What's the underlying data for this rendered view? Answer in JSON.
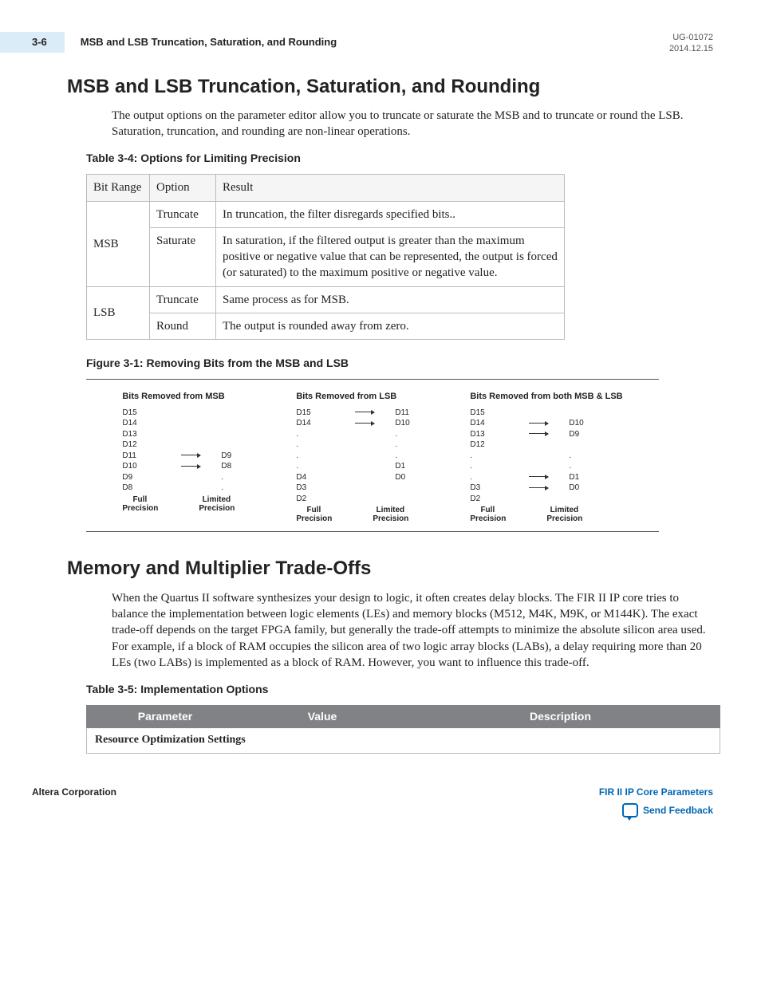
{
  "header": {
    "page_num": "3-6",
    "running_title": "MSB and LSB Truncation, Saturation, and Rounding",
    "doc_id": "UG-01072",
    "date": "2014.12.15"
  },
  "section1": {
    "title": "MSB and LSB Truncation, Saturation, and Rounding",
    "body": "The output options on the parameter editor allow you to truncate or saturate the MSB and to truncate or round the LSB. Saturation, truncation, and rounding are non-linear operations."
  },
  "table34": {
    "caption": "Table 3-4: Options for Limiting Precision",
    "headers": [
      "Bit Range",
      "Option",
      "Result"
    ],
    "rows": [
      {
        "range": "MSB",
        "option": "Truncate",
        "result": "In truncation, the filter disregards specified bits.."
      },
      {
        "range": "MSB",
        "option": "Saturate",
        "result": "In saturation, if the filtered output is greater than the maximum positive or negative value that can be represented, the output is forced (or saturated) to the maximum positive or negative value."
      },
      {
        "range": "LSB",
        "option": "Truncate",
        "result": "Same process as for MSB."
      },
      {
        "range": "LSB",
        "option": "Round",
        "result": "The output is rounded away from zero."
      }
    ]
  },
  "figure31": {
    "caption": "Figure 3-1: Removing Bits from the MSB and LSB",
    "cols": [
      {
        "title": "Bits Removed from MSB",
        "full": [
          "D15",
          "D14",
          "D13",
          "D12",
          "D11",
          "D10",
          "D9",
          "D8"
        ],
        "limited": [
          "",
          "",
          "",
          "",
          "D9",
          "D8",
          ".",
          "."
        ],
        "foot_left": "Full Precision",
        "foot_right": "Limited Precision",
        "arrows": {
          "4": true,
          "5": true
        }
      },
      {
        "title": "Bits Removed from LSB",
        "full": [
          "D15",
          "D14",
          ".",
          ".",
          ".",
          ".",
          "D4",
          "D3",
          "D2"
        ],
        "limited": [
          "D11",
          "D10",
          ".",
          ".",
          ".",
          "D1",
          "D0",
          "",
          ""
        ],
        "foot_left": "Full Precision",
        "foot_right": "Limited Precision",
        "arrows": {
          "0": true,
          "1": true
        }
      },
      {
        "title": "Bits Removed from both MSB & LSB",
        "full": [
          "D15",
          "D14",
          "D13",
          "D12",
          ".",
          ".",
          ".",
          "D3",
          "D2"
        ],
        "limited": [
          "",
          "D10",
          "D9",
          "",
          ".",
          ".",
          "D1",
          "D0",
          ""
        ],
        "foot_left": "Full Precision",
        "foot_right": "Limited Precision",
        "arrows": {
          "1": true,
          "2": true,
          "6": true,
          "7": true
        }
      }
    ]
  },
  "section2": {
    "title": "Memory and Multiplier Trade-Offs",
    "body": "When the Quartus II software synthesizes your design to logic, it often creates delay blocks. The FIR II IP core tries to balance the implementation between logic elements (LEs) and memory blocks (M512, M4K, M9K, or M144K). The exact trade-off depends on the target FPGA family, but generally the trade-off attempts to minimize the absolute silicon area used. For example, if a block of RAM occupies the silicon area of two logic array blocks (LABs), a delay requiring more than 20 LEs (two LABs) is implemented as a block of RAM. However, you want to influence this trade-off."
  },
  "table35": {
    "caption": "Table 3-5: Implementation Options",
    "headers": [
      "Parameter",
      "Value",
      "Description"
    ],
    "section_row": "Resource Optimization Settings"
  },
  "footer": {
    "left": "Altera Corporation",
    "link": "FIR II IP Core Parameters",
    "feedback": "Send Feedback"
  }
}
